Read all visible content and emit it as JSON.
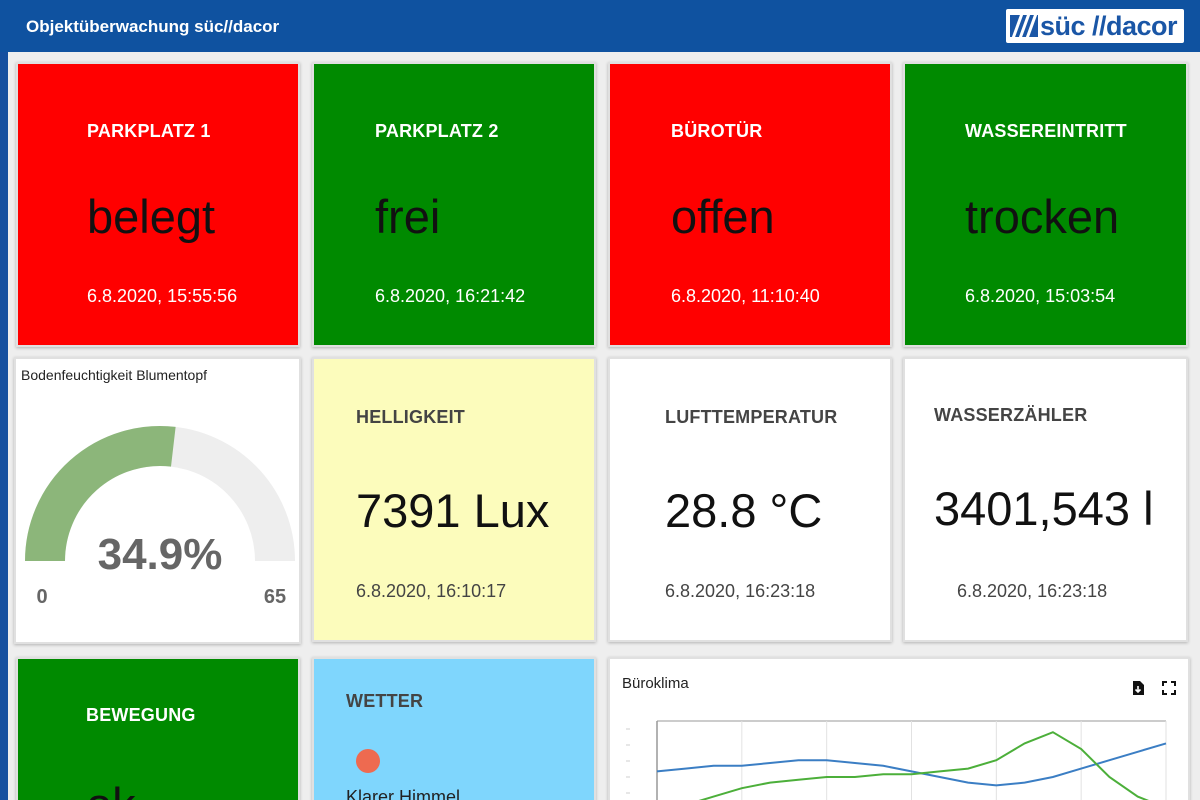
{
  "header": {
    "title": "Objektüberwachung süc//dacor",
    "logo_text": "süc //dacor"
  },
  "tiles": [
    {
      "label": "PARKPLATZ 1",
      "value": "belegt",
      "time": "6.8.2020, 15:55:56",
      "color": "#ff0000"
    },
    {
      "label": "PARKPLATZ 2",
      "value": "frei",
      "time": "6.8.2020, 16:21:42",
      "color": "#008a00"
    },
    {
      "label": "BÜROTÜR",
      "value": "offen",
      "time": "6.8.2020, 11:10:40",
      "color": "#ff0000"
    },
    {
      "label": "WASSEREINTRITT",
      "value": "trocken",
      "time": "6.8.2020, 15:03:54",
      "color": "#008a00"
    },
    {
      "label": "HELLIGKEIT",
      "value": "7391 Lux",
      "time": "6.8.2020, 16:10:17",
      "color": "#fcfcbc"
    },
    {
      "label": "LUFTTEMPERATUR",
      "value": "28.8 °C",
      "time": "6.8.2020, 16:23:18",
      "color": "#ffffff"
    },
    {
      "label": "WASSERZÄHLER",
      "value": "3401,543 l",
      "time": "6.8.2020, 16:23:18",
      "color": "#ffffff"
    },
    {
      "label": "BEWEGUNG",
      "value": "ok",
      "color": "#008a00"
    }
  ],
  "gauge": {
    "title": "Bodenfeuchtigkeit Blumentopf",
    "value": 34.9,
    "value_text": "34.9%",
    "min": 0,
    "max": 65,
    "min_text": "0",
    "max_text": "65",
    "fill_color": "#8cb67a",
    "track_color": "#eeeeee"
  },
  "weather": {
    "label": "WETTER",
    "condition": "Klarer Himmel",
    "icon": "sun-icon",
    "color": "#7fd6fd"
  },
  "chart": {
    "title": "Büroklima",
    "icons": [
      "export-icon",
      "fullscreen-icon"
    ]
  },
  "chart_data": {
    "type": "line",
    "title": "Büroklima",
    "series": [
      {
        "color": "#3b7ec4",
        "values": [
          28.2,
          28.3,
          28.4,
          28.4,
          28.5,
          28.6,
          28.6,
          28.5,
          28.4,
          28.2,
          28.0,
          27.8,
          27.7,
          27.8,
          28.0,
          28.3,
          28.6,
          28.9,
          29.2
        ]
      },
      {
        "color": "#4caf3a",
        "values": [
          26.9,
          27.0,
          27.3,
          27.6,
          27.8,
          27.9,
          28.0,
          28.0,
          28.1,
          28.1,
          28.2,
          28.3,
          28.6,
          29.2,
          29.6,
          29.0,
          28.0,
          27.3,
          26.9
        ]
      }
    ],
    "ylim": [
      26.5,
      30.0
    ],
    "grid": true
  }
}
